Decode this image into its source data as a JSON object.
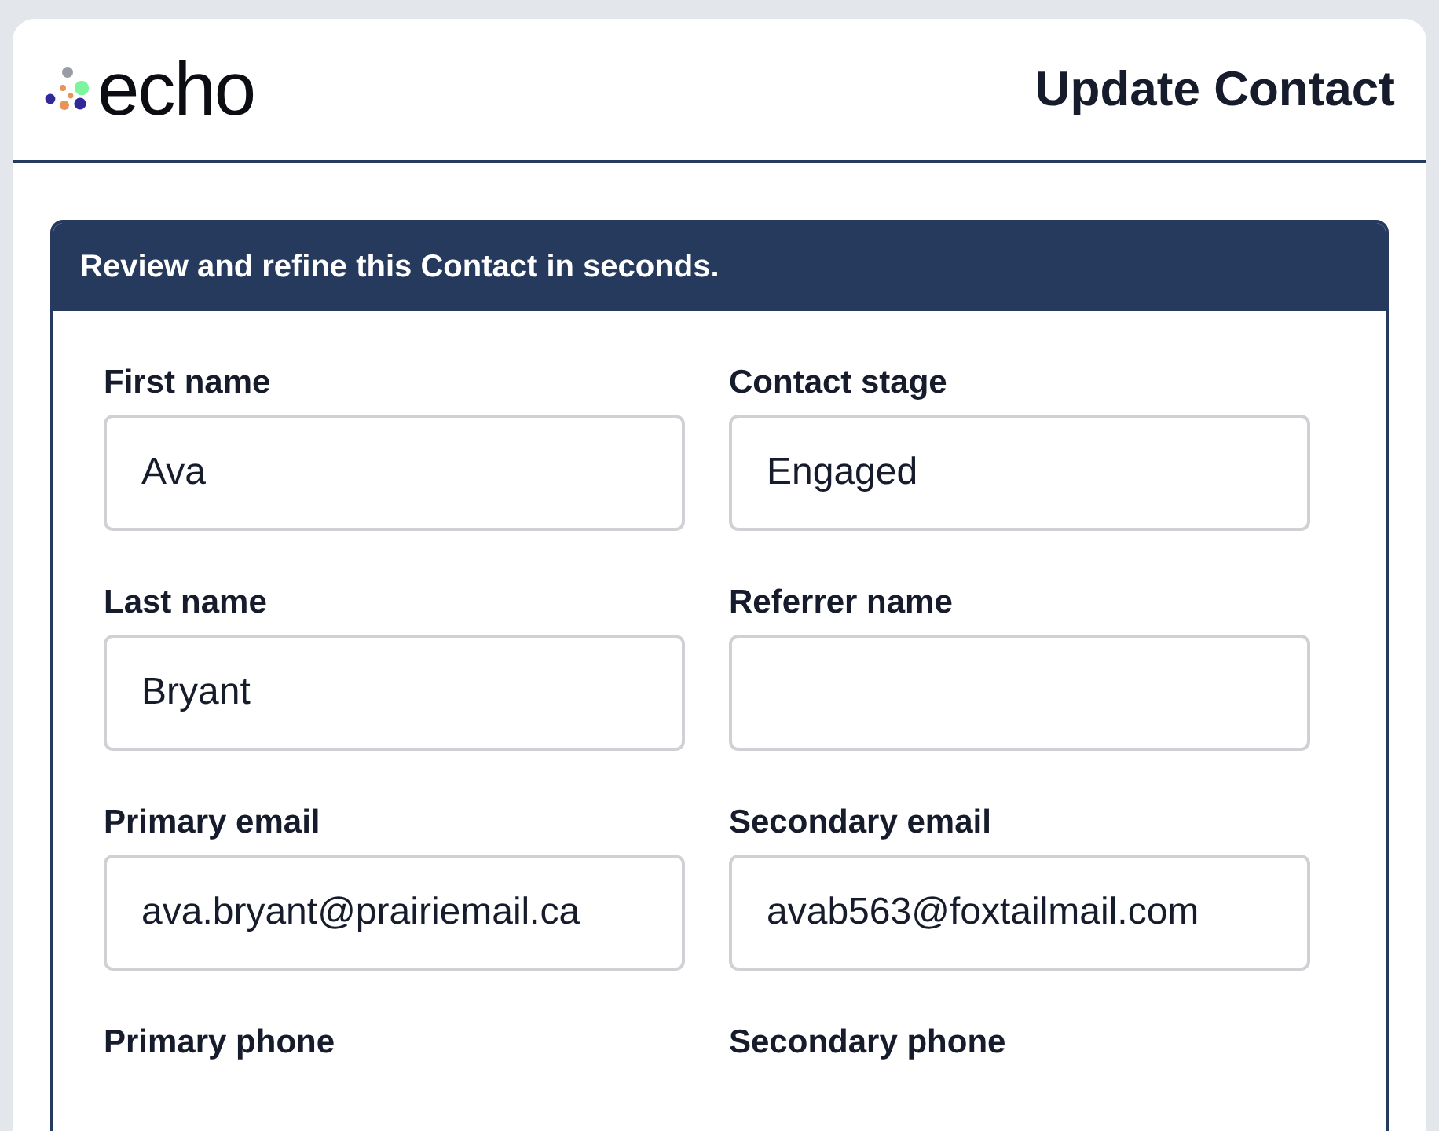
{
  "header": {
    "logo_text": "echo",
    "title": "Update Contact"
  },
  "panel": {
    "banner": "Review and refine this Contact in seconds.",
    "fields": [
      {
        "kind": "text-field",
        "label": "First name",
        "value": "Ava"
      },
      {
        "kind": "text-field",
        "label": "Contact stage",
        "value": "Engaged"
      },
      {
        "kind": "text-field",
        "label": "Last name",
        "value": "Bryant"
      },
      {
        "kind": "text-field",
        "label": "Referrer name"
      },
      {
        "kind": "text-field",
        "label": "Primary email",
        "value": "ava.bryant@prairiemail.ca"
      },
      {
        "kind": "text-field",
        "label": "Secondary email",
        "value": "avab563@foxtailmail.com"
      },
      {
        "kind": "label-only",
        "label": "Primary phone"
      },
      {
        "kind": "label-only",
        "label": "Secondary phone"
      }
    ]
  }
}
